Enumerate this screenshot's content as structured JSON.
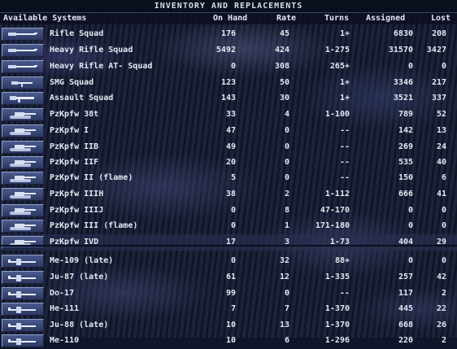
{
  "title": "INVENTORY AND REPLACEMENTS",
  "columns": {
    "systems": "Available Systems",
    "on_hand": "On Hand",
    "rate": "Rate",
    "turns": "Turns",
    "assigned": "Assigned",
    "lost": "Lost"
  },
  "rows": [
    {
      "name": "Rifle Squad",
      "on_hand": "176",
      "rate": "45",
      "turns": "1+",
      "assigned": "6830",
      "lost": "208",
      "icon": "rifle-icon"
    },
    {
      "name": "Heavy Rifle Squad",
      "on_hand": "5492",
      "rate": "424",
      "turns": "1-275",
      "assigned": "31570",
      "lost": "3427",
      "icon": "rifle-icon"
    },
    {
      "name": "Heavy Rifle AT- Squad",
      "on_hand": "0",
      "rate": "308",
      "turns": "265+",
      "assigned": "0",
      "lost": "0",
      "icon": "rifle-icon"
    },
    {
      "name": "SMG Squad",
      "on_hand": "123",
      "rate": "50",
      "turns": "1+",
      "assigned": "3346",
      "lost": "217",
      "icon": "smg-icon"
    },
    {
      "name": "Assault Squad",
      "on_hand": "143",
      "rate": "30",
      "turns": "1+",
      "assigned": "3521",
      "lost": "337",
      "icon": "assault-rifle-icon"
    },
    {
      "name": "PzKpfw 38t",
      "on_hand": "33",
      "rate": "4",
      "turns": "1-100",
      "assigned": "789",
      "lost": "52",
      "icon": "tank-icon"
    },
    {
      "name": "PzKpfw I",
      "on_hand": "47",
      "rate": "0",
      "turns": "--",
      "assigned": "142",
      "lost": "13",
      "icon": "tank-icon"
    },
    {
      "name": "PzKpfw IIB",
      "on_hand": "49",
      "rate": "0",
      "turns": "--",
      "assigned": "269",
      "lost": "24",
      "icon": "tank-icon"
    },
    {
      "name": "PzKpfw IIF",
      "on_hand": "20",
      "rate": "0",
      "turns": "--",
      "assigned": "535",
      "lost": "40",
      "icon": "tank-icon"
    },
    {
      "name": "PzKpfw II (flame)",
      "on_hand": "5",
      "rate": "0",
      "turns": "--",
      "assigned": "150",
      "lost": "6",
      "icon": "tank-icon"
    },
    {
      "name": "PzKpfw IIIH",
      "on_hand": "38",
      "rate": "2",
      "turns": "1-112",
      "assigned": "666",
      "lost": "41",
      "icon": "tank-icon"
    },
    {
      "name": "PzKpfw IIIJ",
      "on_hand": "0",
      "rate": "8",
      "turns": "47-170",
      "assigned": "0",
      "lost": "0",
      "icon": "tank-icon"
    },
    {
      "name": "PzKpfw III (flame)",
      "on_hand": "0",
      "rate": "1",
      "turns": "171-180",
      "assigned": "0",
      "lost": "0",
      "icon": "tank-icon"
    },
    {
      "name": "PzKpfw IVD",
      "on_hand": "17",
      "rate": "3",
      "turns": "1-73",
      "assigned": "404",
      "lost": "29",
      "icon": "tank-icon"
    },
    {
      "name": "Me-109 (late)",
      "on_hand": "0",
      "rate": "32",
      "turns": "88+",
      "assigned": "0",
      "lost": "0",
      "icon": "aircraft-icon"
    },
    {
      "name": "Ju-87 (late)",
      "on_hand": "61",
      "rate": "12",
      "turns": "1-335",
      "assigned": "257",
      "lost": "42",
      "icon": "aircraft-icon"
    },
    {
      "name": "Do-17",
      "on_hand": "99",
      "rate": "0",
      "turns": "--",
      "assigned": "117",
      "lost": "2",
      "icon": "aircraft-icon"
    },
    {
      "name": "He-111",
      "on_hand": "7",
      "rate": "7",
      "turns": "1-370",
      "assigned": "445",
      "lost": "22",
      "icon": "aircraft-icon"
    },
    {
      "name": "Ju-88 (late)",
      "on_hand": "10",
      "rate": "13",
      "turns": "1-370",
      "assigned": "668",
      "lost": "26",
      "icon": "aircraft-icon"
    },
    {
      "name": "Me-110",
      "on_hand": "10",
      "rate": "6",
      "turns": "1-296",
      "assigned": "220",
      "lost": "2",
      "icon": "aircraft-icon"
    }
  ],
  "colors": {
    "text": "#e4e8f2",
    "button": "#3c4a78",
    "title_bar": "#0a0f1e"
  }
}
